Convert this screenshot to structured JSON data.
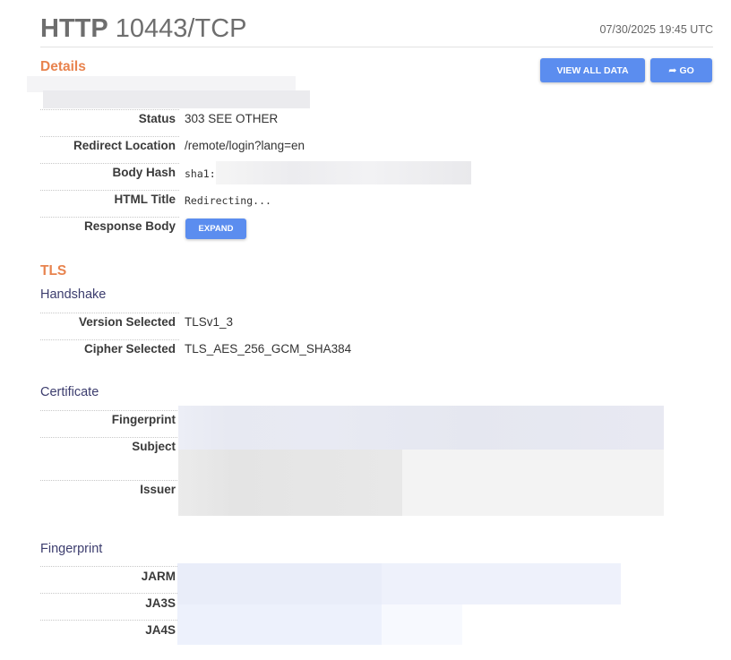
{
  "header": {
    "protocol": "HTTP",
    "port_transport": "10443/TCP",
    "timestamp": "07/30/2025 19:45 UTC"
  },
  "actions": {
    "view_all_label": "VIEW ALL DATA",
    "go_label": "GO",
    "go_icon": "share-arrow-icon"
  },
  "details": {
    "title": "Details",
    "rows": {
      "status": {
        "label": "Status",
        "value": "303  SEE OTHER"
      },
      "redirect": {
        "label": "Redirect Location",
        "value": "/remote/login?lang=en"
      },
      "body_hash": {
        "label": "Body Hash",
        "value": "sha1:"
      },
      "html_title": {
        "label": "HTML Title",
        "value": "Redirecting..."
      },
      "response_body": {
        "label": "Response Body",
        "button": "EXPAND"
      }
    }
  },
  "tls": {
    "title": "TLS",
    "handshake": {
      "title": "Handshake",
      "version": {
        "label": "Version Selected",
        "value": "TLSv1_3"
      },
      "cipher": {
        "label": "Cipher Selected",
        "value": "TLS_AES_256_GCM_SHA384"
      }
    },
    "certificate": {
      "title": "Certificate",
      "fingerprint_label": "Fingerprint",
      "subject_label": "Subject",
      "issuer_label": "Issuer"
    },
    "fingerprint": {
      "title": "Fingerprint",
      "jarm_label": "JARM",
      "ja3s_label": "JA3S",
      "ja4s_label": "JA4S"
    }
  },
  "colors": {
    "accent_orange": "#e8834e",
    "button_blue": "#5b8def",
    "subheading_navy": "#3c3d6e"
  }
}
